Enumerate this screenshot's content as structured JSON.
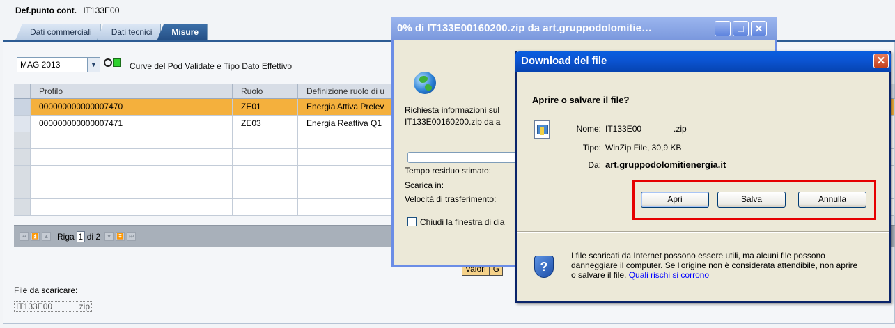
{
  "sap": {
    "title_label": "Def.punto cont.",
    "title_value": "IT133E00",
    "tabs": [
      {
        "label": "Dati commerciali"
      },
      {
        "label": "Dati tecnici"
      },
      {
        "label": "Misure"
      }
    ],
    "period_select": "MAG 2013",
    "curve_label": "Curve del Pod Validate e Tipo Dato Effettivo",
    "grid": {
      "headers": [
        "Profilo",
        "Ruolo",
        "Definizione ruolo di u"
      ],
      "rows": [
        {
          "profilo": "000000000000007470",
          "ruolo": "ZE01",
          "definizione": "Energia Attiva Prelev"
        },
        {
          "profilo": "000000000000007471",
          "ruolo": "ZE03",
          "definizione": "Energia Reattiva Q1"
        }
      ]
    },
    "pager": {
      "label": "Riga",
      "page": "1",
      "of": "di 2"
    },
    "file_label": "File da scaricare:",
    "file_link_left": "IT133E00",
    "file_link_right": "zip",
    "valori_buttons": [
      "Valori",
      "G"
    ]
  },
  "progress": {
    "title": "0% di IT133E00160200.zip da art.gruppodolomitie…",
    "line1": "Richiesta informazioni sul",
    "line2": "IT133E00160200.zip da a",
    "tempo": "Tempo residuo stimato:",
    "scarica": "Scarica in:",
    "velocita": "Velocità di trasferimento:",
    "checkbox_label": "Chiudi la finestra di dia",
    "percent": 0
  },
  "download": {
    "title": "Download del file",
    "close": "✕",
    "question": "Aprire o salvare il file?",
    "name_key": "Nome:",
    "name_val": "IT133E00",
    "name_ext": ".zip",
    "type_key": "Tipo:",
    "type_val": "WinZip File, 30,9 KB",
    "from_key": "Da:",
    "from_val": "art.gruppodolomitienergia.it",
    "btn_open": "Apri",
    "btn_save": "Salva",
    "btn_cancel": "Annulla",
    "warning": "I file scaricati da Internet possono essere utili, ma alcuni file possono danneggiare il computer. Se l'origine non è considerata attendibile, non aprire o salvare il file.",
    "warning_link": "Quali rischi si corrono"
  },
  "colors": {
    "selected_row": "#f4b03d",
    "highlight_box": "#e60000",
    "status_green": "#2fd12f",
    "xp_titlebar": "#0b53d0"
  }
}
